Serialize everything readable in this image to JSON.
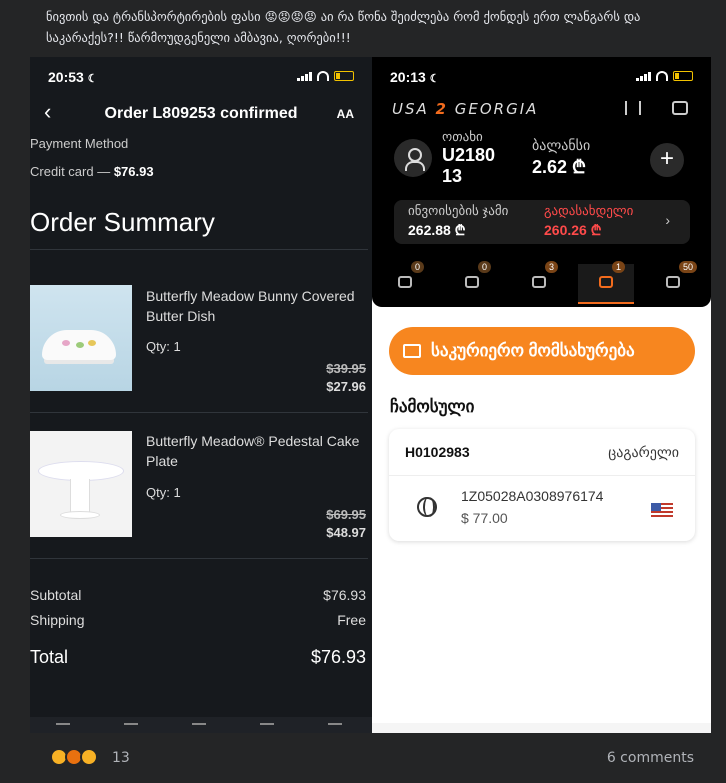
{
  "post": {
    "text": "ნივთის და ტრანსპორტირების ფასი 😡😡😡😡 აი რა წონა შეიძლება რომ ქონდეს ერთ ლანგარს და საკარაქეს?!! წარმოუდგენელი ამბავია, ღორები!!!"
  },
  "left_phone": {
    "time": "20:53",
    "title": "Order L809253 confirmed",
    "aa_label": "AA",
    "payment_label": "Payment Method",
    "payment_method": "Credit card — ",
    "payment_amount": "$76.93",
    "summary_title": "Order Summary",
    "items": [
      {
        "name": "Butterfly Meadow Bunny Covered Butter Dish",
        "qty": "Qty: 1",
        "old_price": "$39.95",
        "new_price": "$27.96"
      },
      {
        "name": "Butterfly Meadow® Pedestal Cake Plate",
        "qty": "Qty: 1",
        "old_price": "$69.95",
        "new_price": "$48.97"
      }
    ],
    "subtotal_label": "Subtotal",
    "subtotal_value": "$76.93",
    "shipping_label": "Shipping",
    "shipping_value": "Free",
    "total_label": "Total",
    "total_value": "$76.93"
  },
  "right_phone": {
    "time": "20:13",
    "brand_a": "USA",
    "brand_b": "2",
    "brand_c": "GEORGIA",
    "room_label": "ოთახი",
    "room_value": "U2180 13",
    "balance_label": "ბალანსი",
    "balance_value": "2.62 ₾",
    "invoice_label": "ინვოისების ჯამი",
    "invoice_value": "262.88 ₾",
    "due_label": "გადასახდელი",
    "due_value": "260.26 ₾",
    "tabs": [
      {
        "badge": "0",
        "icon": "inbox-icon"
      },
      {
        "badge": "0",
        "icon": "box-icon"
      },
      {
        "badge": "3",
        "icon": "plane-icon"
      },
      {
        "badge": "1",
        "icon": "shoe-icon"
      },
      {
        "badge": "50",
        "icon": "gift-icon"
      }
    ],
    "courier_label": "საკურიერო მომსახურება",
    "arrived_title": "ჩამოსული",
    "parcel": {
      "id": "H0102983",
      "status": "ცაგარელი",
      "tracking": "1Z05028A0308976174",
      "amount": "$ 77.00"
    }
  },
  "footer": {
    "reaction_count": "13",
    "comments": "6 comments"
  },
  "colors": {
    "accent": "#f7861f",
    "due": "#ff4a4a",
    "brand": "#f26b1d"
  }
}
